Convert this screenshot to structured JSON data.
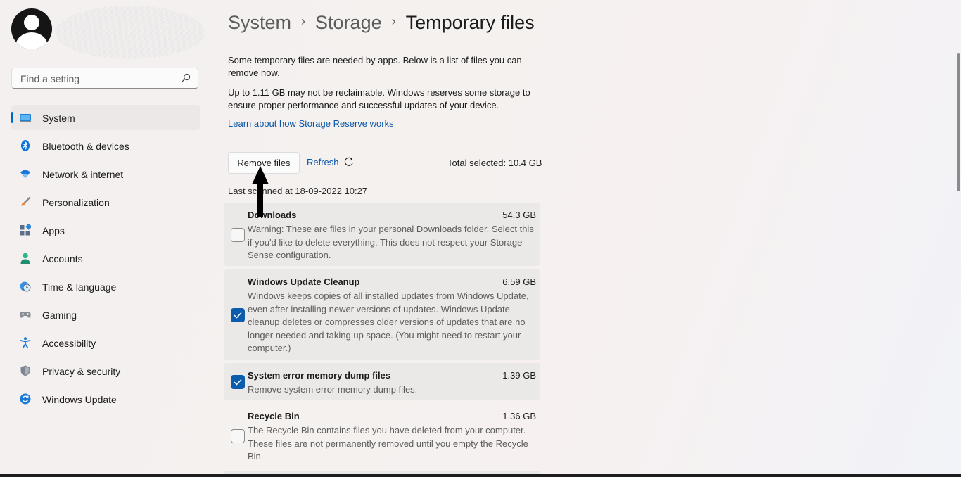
{
  "sidebar": {
    "search": {
      "placeholder": "Find a setting"
    },
    "items": [
      {
        "label": "System",
        "icon": "system-icon",
        "active": true
      },
      {
        "label": "Bluetooth & devices",
        "icon": "bluetooth-icon"
      },
      {
        "label": "Network & internet",
        "icon": "wifi-icon"
      },
      {
        "label": "Personalization",
        "icon": "brush-icon"
      },
      {
        "label": "Apps",
        "icon": "apps-icon"
      },
      {
        "label": "Accounts",
        "icon": "person-icon"
      },
      {
        "label": "Time & language",
        "icon": "globe-clock-icon"
      },
      {
        "label": "Gaming",
        "icon": "gamepad-icon"
      },
      {
        "label": "Accessibility",
        "icon": "accessibility-icon"
      },
      {
        "label": "Privacy & security",
        "icon": "shield-icon"
      },
      {
        "label": "Windows Update",
        "icon": "update-icon"
      }
    ]
  },
  "breadcrumb": {
    "items": [
      "System",
      "Storage"
    ],
    "current": "Temporary files"
  },
  "intro": {
    "line1": "Some temporary files are needed by apps. Below is a list of files you can remove now.",
    "line2": "Up to 1.11 GB may not be reclaimable. Windows reserves some storage to ensure proper performance and successful updates of your device.",
    "link": "Learn about how Storage Reserve works"
  },
  "actions": {
    "remove_label": "Remove files",
    "refresh_label": "Refresh",
    "total_selected": "Total selected: 10.4 GB"
  },
  "last_scanned": "Last scanned at 18-09-2022 10:27",
  "file_items": [
    {
      "title": "Downloads",
      "size": "54.3 GB",
      "checked": false,
      "description": "Warning: These are files in your personal Downloads folder. Select this if you'd like to delete everything. This does not respect your Storage Sense configuration."
    },
    {
      "title": "Windows Update Cleanup",
      "size": "6.59 GB",
      "checked": true,
      "description": "Windows keeps copies of all installed updates from Windows Update, even after installing newer versions of updates. Windows Update cleanup deletes or compresses older versions of updates that are no longer needed and taking up space. (You might need to restart your computer.)"
    },
    {
      "title": "System error memory dump files",
      "size": "1.39 GB",
      "checked": true,
      "description": "Remove system error memory dump files."
    },
    {
      "title": "Recycle Bin",
      "size": "1.36 GB",
      "checked": false,
      "description": "The Recycle Bin contains files you have deleted from your computer. These files are not permanently removed until you empty the Recycle Bin."
    }
  ],
  "colors": {
    "accent": "#0067c0",
    "link": "#0a56a8",
    "card": "#ebe9e8"
  }
}
